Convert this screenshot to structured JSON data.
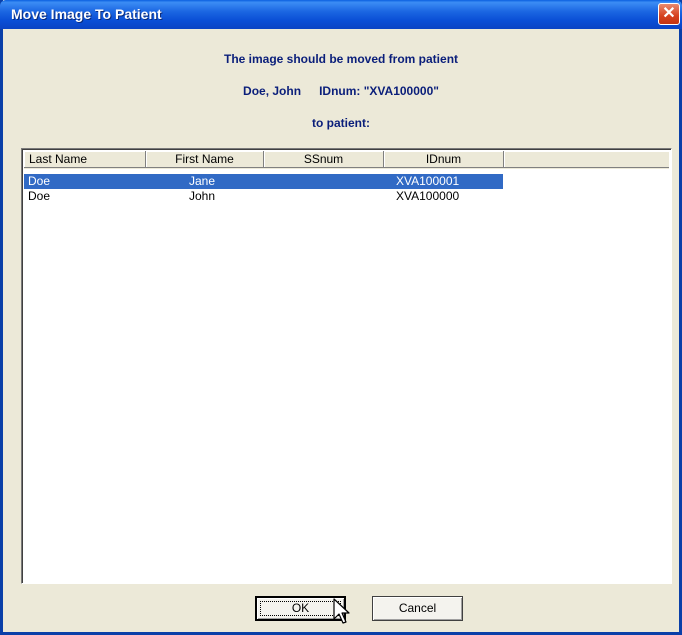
{
  "window": {
    "title": "Move Image To Patient",
    "close_label": "✕"
  },
  "message": {
    "line1": "The image should be moved from patient",
    "from_name": "Doe, John",
    "from_id": "IDnum: \"XVA100000\"",
    "line3": "to patient:"
  },
  "table": {
    "columns": [
      "Last Name",
      "First Name",
      "SSnum",
      "IDnum"
    ],
    "rows": [
      {
        "last_name": "Doe",
        "first_name": "Jane",
        "ssnum": "",
        "idnum": "XVA100001",
        "selected": true
      },
      {
        "last_name": "Doe",
        "first_name": "John",
        "ssnum": "",
        "idnum": "XVA100000",
        "selected": false
      }
    ]
  },
  "buttons": {
    "ok": "OK",
    "cancel": "Cancel"
  },
  "colors": {
    "title_blue": "#0a4fd6",
    "selection": "#316ac5",
    "message_text": "#0a1e7a",
    "face": "#ece9d8",
    "close_red": "#d6411e"
  },
  "icons": {
    "close": "close-icon",
    "cursor": "arrow-cursor-icon"
  }
}
